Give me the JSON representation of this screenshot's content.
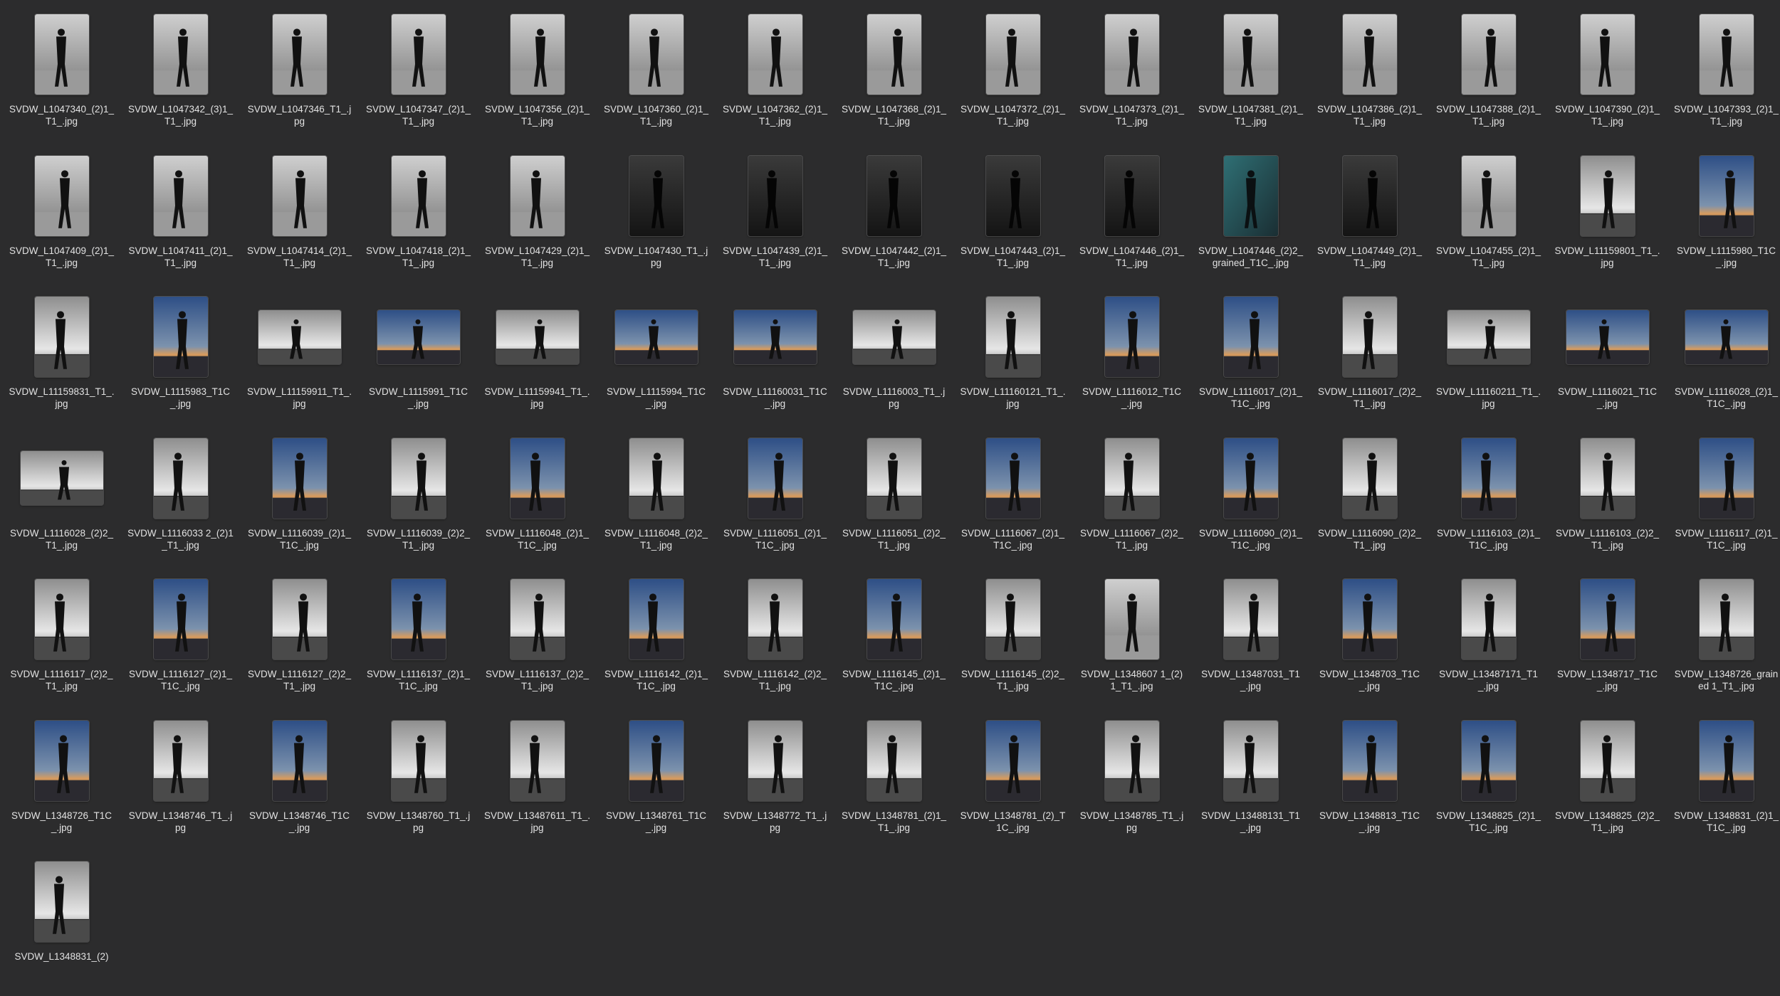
{
  "window_title": "",
  "files": [
    {
      "name": "SVDW_L1047340_(2)1_T1_.jpg",
      "kind": "bw",
      "orientation": "portrait",
      "icon": "image-thumbnail"
    },
    {
      "name": "SVDW_L1047342_(3)1_T1_.jpg",
      "kind": "bw",
      "orientation": "portrait",
      "icon": "image-thumbnail"
    },
    {
      "name": "SVDW_L1047346_T1_.jpg",
      "kind": "bw",
      "orientation": "portrait",
      "icon": "image-thumbnail"
    },
    {
      "name": "SVDW_L1047347_(2)1_T1_.jpg",
      "kind": "bw",
      "orientation": "portrait",
      "icon": "image-thumbnail"
    },
    {
      "name": "SVDW_L1047356_(2)1_T1_.jpg",
      "kind": "bw",
      "orientation": "portrait",
      "icon": "image-thumbnail"
    },
    {
      "name": "SVDW_L1047360_(2)1_T1_.jpg",
      "kind": "bw",
      "orientation": "portrait",
      "icon": "image-thumbnail"
    },
    {
      "name": "SVDW_L1047362_(2)1_T1_.jpg",
      "kind": "bw",
      "orientation": "portrait",
      "icon": "image-thumbnail"
    },
    {
      "name": "SVDW_L1047368_(2)1_T1_.jpg",
      "kind": "bw",
      "orientation": "portrait",
      "icon": "image-thumbnail"
    },
    {
      "name": "SVDW_L1047372_(2)1_T1_.jpg",
      "kind": "bw",
      "orientation": "portrait",
      "icon": "image-thumbnail"
    },
    {
      "name": "SVDW_L1047373_(2)1_T1_.jpg",
      "kind": "bw",
      "orientation": "portrait",
      "icon": "image-thumbnail"
    },
    {
      "name": "SVDW_L1047381_(2)1_T1_.jpg",
      "kind": "bw",
      "orientation": "portrait",
      "icon": "image-thumbnail"
    },
    {
      "name": "SVDW_L1047386_(2)1_T1_.jpg",
      "kind": "bw",
      "orientation": "portrait",
      "icon": "image-thumbnail"
    },
    {
      "name": "SVDW_L1047388_(2)1_T1_.jpg",
      "kind": "bw",
      "orientation": "portrait",
      "icon": "image-thumbnail"
    },
    {
      "name": "SVDW_L1047390_(2)1_T1_.jpg",
      "kind": "bw",
      "orientation": "portrait",
      "icon": "image-thumbnail"
    },
    {
      "name": "SVDW_L1047393_(2)1_T1_.jpg",
      "kind": "bw",
      "orientation": "portrait",
      "icon": "image-thumbnail"
    },
    {
      "name": "SVDW_L1047409_(2)1_T1_.jpg",
      "kind": "bw",
      "orientation": "portrait",
      "icon": "image-thumbnail"
    },
    {
      "name": "SVDW_L1047411_(2)1_T1_.jpg",
      "kind": "bw",
      "orientation": "portrait",
      "icon": "image-thumbnail"
    },
    {
      "name": "SVDW_L1047414_(2)1_T1_.jpg",
      "kind": "bw",
      "orientation": "portrait",
      "icon": "image-thumbnail"
    },
    {
      "name": "SVDW_L1047418_(2)1_T1_.jpg",
      "kind": "bw",
      "orientation": "portrait",
      "icon": "image-thumbnail"
    },
    {
      "name": "SVDW_L1047429_(2)1_T1_.jpg",
      "kind": "bw",
      "orientation": "portrait",
      "icon": "image-thumbnail"
    },
    {
      "name": "SVDW_L1047430_T1_.jpg",
      "kind": "dark",
      "orientation": "portrait",
      "icon": "image-thumbnail"
    },
    {
      "name": "SVDW_L1047439_(2)1_T1_.jpg",
      "kind": "dark",
      "orientation": "portrait",
      "icon": "image-thumbnail"
    },
    {
      "name": "SVDW_L1047442_(2)1_T1_.jpg",
      "kind": "dark",
      "orientation": "portrait",
      "icon": "image-thumbnail"
    },
    {
      "name": "SVDW_L1047443_(2)1_T1_.jpg",
      "kind": "dark",
      "orientation": "portrait",
      "icon": "image-thumbnail"
    },
    {
      "name": "SVDW_L1047446_(2)1_T1_.jpg",
      "kind": "dark",
      "orientation": "portrait",
      "icon": "image-thumbnail"
    },
    {
      "name": "SVDW_L1047446_(2)2_grained_T1C_.jpg",
      "kind": "teal",
      "orientation": "portrait",
      "icon": "image-thumbnail"
    },
    {
      "name": "SVDW_L1047449_(2)1_T1_.jpg",
      "kind": "dark",
      "orientation": "portrait",
      "icon": "image-thumbnail"
    },
    {
      "name": "SVDW_L1047455_(2)1_T1_.jpg",
      "kind": "bw",
      "orientation": "portrait",
      "icon": "image-thumbnail"
    },
    {
      "name": "SVDW_L11159801_T1_.jpg",
      "kind": "bwsky",
      "orientation": "portrait",
      "icon": "image-thumbnail"
    },
    {
      "name": "SVDW_L1115980_T1C_.jpg",
      "kind": "color",
      "orientation": "portrait",
      "icon": "image-thumbnail"
    },
    {
      "name": "SVDW_L11159831_T1_.jpg",
      "kind": "bwsky",
      "orientation": "portrait",
      "icon": "image-thumbnail"
    },
    {
      "name": "SVDW_L1115983_T1C_.jpg",
      "kind": "color",
      "orientation": "portrait",
      "icon": "image-thumbnail"
    },
    {
      "name": "SVDW_L11159911_T1_.jpg",
      "kind": "bwsky",
      "orientation": "landscape",
      "icon": "image-thumbnail"
    },
    {
      "name": "SVDW_L1115991_T1C_.jpg",
      "kind": "color",
      "orientation": "landscape",
      "icon": "image-thumbnail"
    },
    {
      "name": "SVDW_L11159941_T1_.jpg",
      "kind": "bwsky",
      "orientation": "landscape",
      "icon": "image-thumbnail"
    },
    {
      "name": "SVDW_L1115994_T1C_.jpg",
      "kind": "color",
      "orientation": "landscape",
      "icon": "image-thumbnail"
    },
    {
      "name": "SVDW_L11160031_T1C_.jpg",
      "kind": "color",
      "orientation": "landscape",
      "icon": "image-thumbnail"
    },
    {
      "name": "SVDW_L1116003_T1_.jpg",
      "kind": "bwsky",
      "orientation": "landscape",
      "icon": "image-thumbnail"
    },
    {
      "name": "SVDW_L11160121_T1_.jpg",
      "kind": "bwsky",
      "orientation": "portrait",
      "icon": "image-thumbnail"
    },
    {
      "name": "SVDW_L1116012_T1C_.jpg",
      "kind": "color",
      "orientation": "portrait",
      "icon": "image-thumbnail"
    },
    {
      "name": "SVDW_L1116017_(2)1_T1C_.jpg",
      "kind": "color",
      "orientation": "portrait",
      "icon": "image-thumbnail"
    },
    {
      "name": "SVDW_L1116017_(2)2_T1_.jpg",
      "kind": "bwsky",
      "orientation": "portrait",
      "icon": "image-thumbnail"
    },
    {
      "name": "SVDW_L11160211_T1_.jpg",
      "kind": "bwsky",
      "orientation": "landscape",
      "icon": "image-thumbnail"
    },
    {
      "name": "SVDW_L1116021_T1C_.jpg",
      "kind": "color",
      "orientation": "landscape",
      "icon": "image-thumbnail"
    },
    {
      "name": "SVDW_L1116028_(2)1_T1C_.jpg",
      "kind": "color",
      "orientation": "landscape",
      "icon": "image-thumbnail"
    },
    {
      "name": "SVDW_L1116028_(2)2_T1_.jpg",
      "kind": "bwsky",
      "orientation": "landscape",
      "icon": "image-thumbnail"
    },
    {
      "name": "SVDW_L1116033 2_(2)1_T1_.jpg",
      "kind": "bwsky",
      "orientation": "portrait",
      "icon": "image-thumbnail"
    },
    {
      "name": "SVDW_L1116039_(2)1_T1C_.jpg",
      "kind": "color",
      "orientation": "portrait",
      "icon": "image-thumbnail"
    },
    {
      "name": "SVDW_L1116039_(2)2_T1_.jpg",
      "kind": "bwsky",
      "orientation": "portrait",
      "icon": "image-thumbnail"
    },
    {
      "name": "SVDW_L1116048_(2)1_T1C_.jpg",
      "kind": "color",
      "orientation": "portrait",
      "icon": "image-thumbnail"
    },
    {
      "name": "SVDW_L1116048_(2)2_T1_.jpg",
      "kind": "bwsky",
      "orientation": "portrait",
      "icon": "image-thumbnail"
    },
    {
      "name": "SVDW_L1116051_(2)1_T1C_.jpg",
      "kind": "color",
      "orientation": "portrait",
      "icon": "image-thumbnail"
    },
    {
      "name": "SVDW_L1116051_(2)2_T1_.jpg",
      "kind": "bwsky",
      "orientation": "portrait",
      "icon": "image-thumbnail"
    },
    {
      "name": "SVDW_L1116067_(2)1_T1C_.jpg",
      "kind": "color",
      "orientation": "portrait",
      "icon": "image-thumbnail"
    },
    {
      "name": "SVDW_L1116067_(2)2_T1_.jpg",
      "kind": "bwsky",
      "orientation": "portrait",
      "icon": "image-thumbnail"
    },
    {
      "name": "SVDW_L1116090_(2)1_T1C_.jpg",
      "kind": "color",
      "orientation": "portrait",
      "icon": "image-thumbnail"
    },
    {
      "name": "SVDW_L1116090_(2)2_T1_.jpg",
      "kind": "bwsky",
      "orientation": "portrait",
      "icon": "image-thumbnail"
    },
    {
      "name": "SVDW_L1116103_(2)1_T1C_.jpg",
      "kind": "color",
      "orientation": "portrait",
      "icon": "image-thumbnail"
    },
    {
      "name": "SVDW_L1116103_(2)2_T1_.jpg",
      "kind": "bwsky",
      "orientation": "portrait",
      "icon": "image-thumbnail"
    },
    {
      "name": "SVDW_L1116117_(2)1_T1C_.jpg",
      "kind": "color",
      "orientation": "portrait",
      "icon": "image-thumbnail"
    },
    {
      "name": "SVDW_L1116117_(2)2_T1_.jpg",
      "kind": "bwsky",
      "orientation": "portrait",
      "icon": "image-thumbnail"
    },
    {
      "name": "SVDW_L1116127_(2)1_T1C_.jpg",
      "kind": "color",
      "orientation": "portrait",
      "icon": "image-thumbnail"
    },
    {
      "name": "SVDW_L1116127_(2)2_T1_.jpg",
      "kind": "bwsky",
      "orientation": "portrait",
      "icon": "image-thumbnail"
    },
    {
      "name": "SVDW_L1116137_(2)1_T1C_.jpg",
      "kind": "color",
      "orientation": "portrait",
      "icon": "image-thumbnail"
    },
    {
      "name": "SVDW_L1116137_(2)2_T1_.jpg",
      "kind": "bwsky",
      "orientation": "portrait",
      "icon": "image-thumbnail"
    },
    {
      "name": "SVDW_L1116142_(2)1_T1C_.jpg",
      "kind": "color",
      "orientation": "portrait",
      "icon": "image-thumbnail"
    },
    {
      "name": "SVDW_L1116142_(2)2_T1_.jpg",
      "kind": "bwsky",
      "orientation": "portrait",
      "icon": "image-thumbnail"
    },
    {
      "name": "SVDW_L1116145_(2)1_T1C_.jpg",
      "kind": "color",
      "orientation": "portrait",
      "icon": "image-thumbnail"
    },
    {
      "name": "SVDW_L1116145_(2)2_T1_.jpg",
      "kind": "bwsky",
      "orientation": "portrait",
      "icon": "image-thumbnail"
    },
    {
      "name": "SVDW_L1348607 1_(2)1_T1_.jpg",
      "kind": "bw",
      "orientation": "portrait",
      "icon": "image-thumbnail"
    },
    {
      "name": "SVDW_L13487031_T1_.jpg",
      "kind": "bwsky",
      "orientation": "portrait",
      "icon": "image-thumbnail"
    },
    {
      "name": "SVDW_L1348703_T1C_.jpg",
      "kind": "color",
      "orientation": "portrait",
      "icon": "image-thumbnail"
    },
    {
      "name": "SVDW_L13487171_T1_.jpg",
      "kind": "bwsky",
      "orientation": "portrait",
      "icon": "image-thumbnail"
    },
    {
      "name": "SVDW_L1348717_T1C_.jpg",
      "kind": "color",
      "orientation": "portrait",
      "icon": "image-thumbnail"
    },
    {
      "name": "SVDW_L1348726_grained 1_T1_.jpg",
      "kind": "bwsky",
      "orientation": "portrait",
      "icon": "image-thumbnail"
    },
    {
      "name": "SVDW_L1348726_T1C_.jpg",
      "kind": "color",
      "orientation": "portrait",
      "icon": "image-thumbnail"
    },
    {
      "name": "SVDW_L1348746_T1_.jpg",
      "kind": "bwsky",
      "orientation": "portrait",
      "icon": "image-thumbnail"
    },
    {
      "name": "SVDW_L1348746_T1C_.jpg",
      "kind": "color",
      "orientation": "portrait",
      "icon": "image-thumbnail"
    },
    {
      "name": "SVDW_L1348760_T1_.jpg",
      "kind": "bwsky",
      "orientation": "portrait",
      "icon": "image-thumbnail"
    },
    {
      "name": "SVDW_L13487611_T1_.jpg",
      "kind": "bwsky",
      "orientation": "portrait",
      "icon": "image-thumbnail"
    },
    {
      "name": "SVDW_L1348761_T1C_.jpg",
      "kind": "color",
      "orientation": "portrait",
      "icon": "image-thumbnail"
    },
    {
      "name": "SVDW_L1348772_T1_.jpg",
      "kind": "bwsky",
      "orientation": "portrait",
      "icon": "image-thumbnail"
    },
    {
      "name": "SVDW_L1348781_(2)1_T1_.jpg",
      "kind": "bwsky",
      "orientation": "portrait",
      "icon": "image-thumbnail"
    },
    {
      "name": "SVDW_L1348781_(2)_T1C_.jpg",
      "kind": "color",
      "orientation": "portrait",
      "icon": "image-thumbnail"
    },
    {
      "name": "SVDW_L1348785_T1_.jpg",
      "kind": "bwsky",
      "orientation": "portrait",
      "icon": "image-thumbnail"
    },
    {
      "name": "SVDW_L13488131_T1_.jpg",
      "kind": "bwsky",
      "orientation": "portrait",
      "icon": "image-thumbnail"
    },
    {
      "name": "SVDW_L1348813_T1C_.jpg",
      "kind": "color",
      "orientation": "portrait",
      "icon": "image-thumbnail"
    },
    {
      "name": "SVDW_L1348825_(2)1_T1C_.jpg",
      "kind": "color",
      "orientation": "portrait",
      "icon": "image-thumbnail"
    },
    {
      "name": "SVDW_L1348825_(2)2_T1_.jpg",
      "kind": "bwsky",
      "orientation": "portrait",
      "icon": "image-thumbnail"
    },
    {
      "name": "SVDW_L1348831_(2)1_T1C_.jpg",
      "kind": "color",
      "orientation": "portrait",
      "icon": "image-thumbnail"
    },
    {
      "name": "SVDW_L1348831_(2)",
      "kind": "bwsky",
      "orientation": "portrait",
      "icon": "image-thumbnail"
    }
  ],
  "colors": {
    "background": "#2c2c2d",
    "label_text": "#e2e2e2"
  }
}
